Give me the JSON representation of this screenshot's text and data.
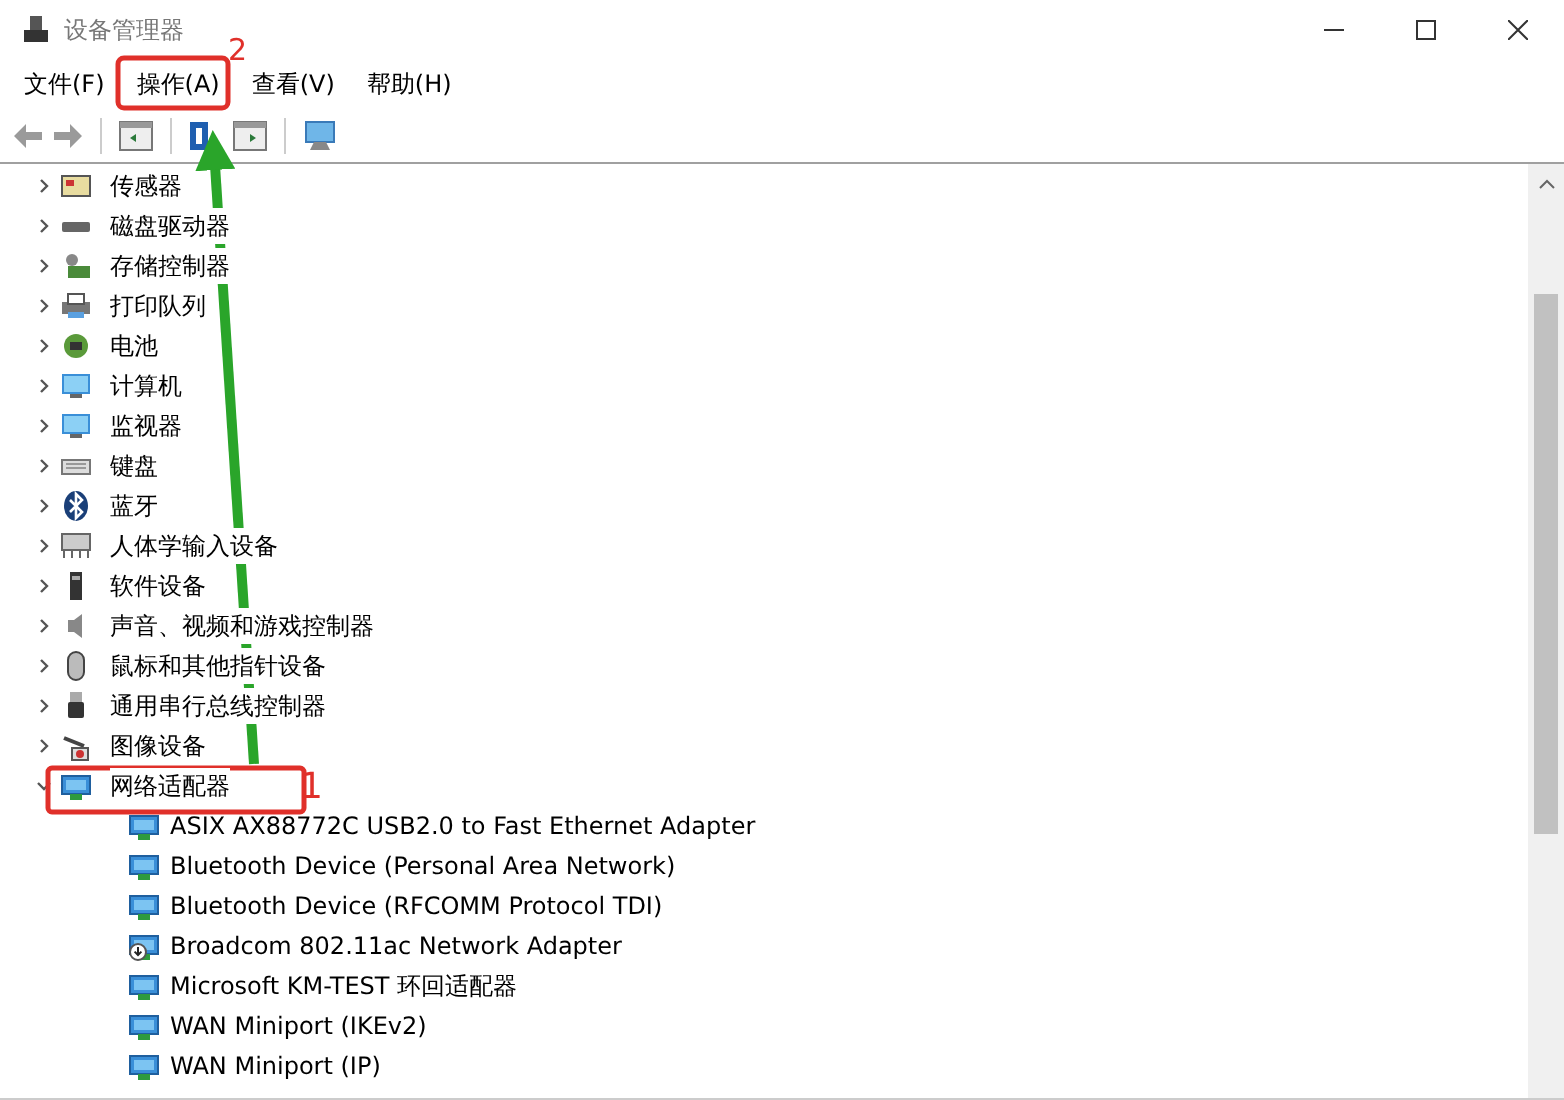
{
  "window": {
    "title": "设备管理器"
  },
  "menu": [
    {
      "label": "文件(F)"
    },
    {
      "label": "操作(A)"
    },
    {
      "label": "查看(V)"
    },
    {
      "label": "帮助(H)"
    }
  ],
  "tree": [
    {
      "label": "传感器",
      "expanded": false
    },
    {
      "label": "磁盘驱动器",
      "expanded": false
    },
    {
      "label": "存储控制器",
      "expanded": false
    },
    {
      "label": "打印队列",
      "expanded": false
    },
    {
      "label": "电池",
      "expanded": false
    },
    {
      "label": "计算机",
      "expanded": false
    },
    {
      "label": "监视器",
      "expanded": false
    },
    {
      "label": "键盘",
      "expanded": false
    },
    {
      "label": "蓝牙",
      "expanded": false
    },
    {
      "label": "人体学输入设备",
      "expanded": false
    },
    {
      "label": "软件设备",
      "expanded": false
    },
    {
      "label": "声音、视频和游戏控制器",
      "expanded": false
    },
    {
      "label": "鼠标和其他指针设备",
      "expanded": false
    },
    {
      "label": "通用串行总线控制器",
      "expanded": false
    },
    {
      "label": "图像设备",
      "expanded": false
    },
    {
      "label": "网络适配器",
      "expanded": true,
      "children": [
        {
          "label": "ASIX AX88772C USB2.0 to Fast Ethernet Adapter",
          "disabled": false
        },
        {
          "label": "Bluetooth Device (Personal Area Network)",
          "disabled": false
        },
        {
          "label": "Bluetooth Device (RFCOMM Protocol TDI)",
          "disabled": false
        },
        {
          "label": "Broadcom 802.11ac Network Adapter",
          "disabled": true
        },
        {
          "label": "Microsoft KM-TEST 环回适配器",
          "disabled": false
        },
        {
          "label": "WAN Miniport (IKEv2)",
          "disabled": false
        },
        {
          "label": "WAN Miniport (IP)",
          "disabled": false
        }
      ]
    }
  ],
  "annotations": [
    {
      "label": "1"
    },
    {
      "label": "2"
    }
  ]
}
